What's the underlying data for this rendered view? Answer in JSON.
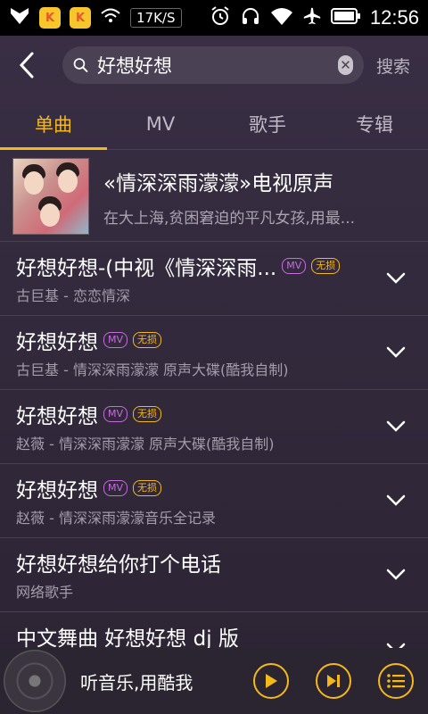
{
  "status_bar": {
    "speed": "17K/S",
    "time": "12:56"
  },
  "search": {
    "query": "好想好想",
    "button_label": "搜索"
  },
  "tabs": [
    {
      "label": "单曲",
      "active": true
    },
    {
      "label": "MV",
      "active": false
    },
    {
      "label": "歌手",
      "active": false
    },
    {
      "label": "专辑",
      "active": false
    }
  ],
  "album": {
    "title": "«情深深雨濛濛»电视原声",
    "subtitle": "在大上海,贫困窘迫的平凡女孩,用最..."
  },
  "songs": [
    {
      "title": "好想好想-(中视《情深深雨...",
      "artist_album": "古巨基 - 恋恋情深",
      "mv": true,
      "lossless": true
    },
    {
      "title": "好想好想",
      "artist_album": "古巨基 - 情深深雨濛濛 原声大碟(酷我自制)",
      "mv": true,
      "lossless": true
    },
    {
      "title": "好想好想",
      "artist_album": "赵薇 - 情深深雨濛濛 原声大碟(酷我自制)",
      "mv": true,
      "lossless": true
    },
    {
      "title": "好想好想",
      "artist_album": "赵薇 - 情深深雨濛濛音乐全记录",
      "mv": true,
      "lossless": true
    },
    {
      "title": "好想好想给你打个电话",
      "artist_album": "网络歌手",
      "mv": false,
      "lossless": false
    },
    {
      "title": "中文舞曲 好想好想 dj 版",
      "artist_album": "",
      "mv": false,
      "lossless": false
    }
  ],
  "badges": {
    "mv": "MV",
    "lossless": "无损"
  },
  "player": {
    "now_playing": "听音乐,用酷我"
  },
  "colors": {
    "accent": "#f5b81b",
    "mv_badge": "#c86be0",
    "background": "#352b3f"
  }
}
